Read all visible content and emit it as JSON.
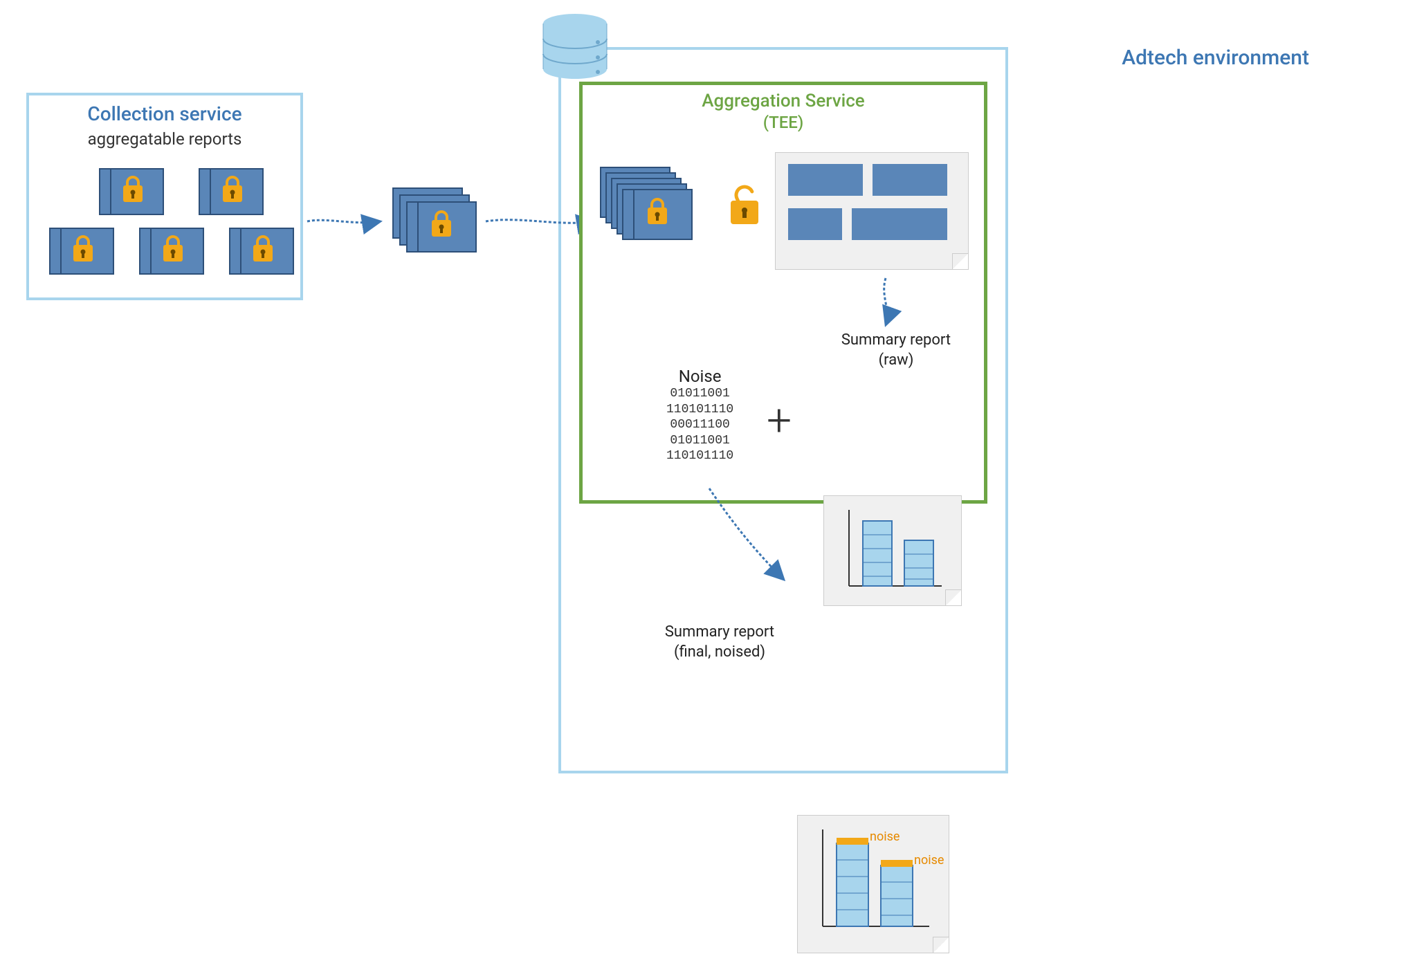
{
  "collection": {
    "title": "Collection service",
    "subtitle": "aggregatable reports"
  },
  "adtech": {
    "title": "Adtech environment"
  },
  "aggregation": {
    "title": "Aggregation Service",
    "subtitle": "(TEE)"
  },
  "noise": {
    "label": "Noise",
    "bits": [
      "01011001",
      "110101110",
      "00011100",
      "01011001",
      "110101110"
    ]
  },
  "plus": "+",
  "summary_raw": {
    "label_line1": "Summary report",
    "label_line2": "(raw)"
  },
  "summary_final": {
    "label_line1": "Summary report",
    "label_line2": "(final, noised)",
    "noise_label": "noise"
  },
  "colors": {
    "blue_border": "#a8d5ed",
    "blue_text": "#3d77b3",
    "green": "#6da544",
    "block_blue": "#5a86b8",
    "lock_orange": "#f2a818"
  }
}
